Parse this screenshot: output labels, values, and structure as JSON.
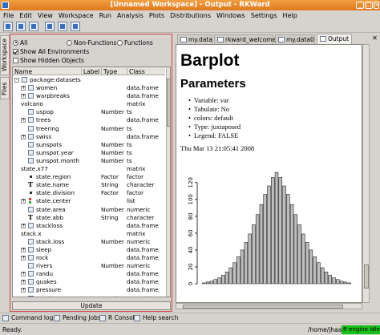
{
  "window": {
    "title": "[Unnamed Workspace] - Output - RKWard",
    "colors": {
      "titlebar": "#e88a2e",
      "selection": "#c44444",
      "r_status": "#17c11a"
    }
  },
  "menu": [
    "File",
    "Edit",
    "View",
    "Workspace",
    "Run",
    "Analysis",
    "Plots",
    "Distributions",
    "Windows",
    "Settings",
    "Help"
  ],
  "sidetabs": [
    "Workspace",
    "Files"
  ],
  "workspace": {
    "filters": {
      "all": "All",
      "non_functions": "Non-Functions",
      "functions": "Functions"
    },
    "show_all_env": "Show All Environments",
    "show_hidden": "Show Hidden Objects",
    "columns": [
      "Name",
      "Label",
      "Type",
      "Class"
    ],
    "rows": [
      {
        "exp": "-",
        "icon": "env",
        "name": "package:datasets",
        "type": "",
        "class": ""
      },
      {
        "exp": "+",
        "icon": "frame",
        "name": "women",
        "type": "",
        "class": "data.frame"
      },
      {
        "exp": "+",
        "icon": "frame",
        "name": "warpbreaks",
        "type": "",
        "class": "data.frame"
      },
      {
        "exp": "",
        "icon": "none",
        "name": "volcano",
        "type": "",
        "class": "matrix"
      },
      {
        "exp": "",
        "icon": "vec",
        "name": "uspop",
        "type": "Number",
        "class": "ts"
      },
      {
        "exp": "+",
        "icon": "frame",
        "name": "trees",
        "type": "",
        "class": "data.frame"
      },
      {
        "exp": "",
        "icon": "vec",
        "name": "treering",
        "type": "Number",
        "class": "ts"
      },
      {
        "exp": "+",
        "icon": "frame",
        "name": "swiss",
        "type": "",
        "class": "data.frame"
      },
      {
        "exp": "",
        "icon": "vec",
        "name": "sunspots",
        "type": "Number",
        "class": "ts"
      },
      {
        "exp": "",
        "icon": "vec",
        "name": "sunspot.year",
        "type": "Number",
        "class": "ts"
      },
      {
        "exp": "",
        "icon": "vec",
        "name": "sunspot.month",
        "type": "Number",
        "class": "ts"
      },
      {
        "exp": "",
        "icon": "none",
        "name": "state.x77",
        "type": "",
        "class": "matrix"
      },
      {
        "exp": "",
        "icon": "factor",
        "name": "state.region",
        "type": "Factor",
        "class": "factor"
      },
      {
        "exp": "",
        "icon": "text",
        "name": "state.name",
        "type": "String",
        "class": "character"
      },
      {
        "exp": "",
        "icon": "factor",
        "name": "state.division",
        "type": "Factor",
        "class": "factor"
      },
      {
        "exp": "+",
        "icon": "list",
        "name": "state.center",
        "type": "",
        "class": "list"
      },
      {
        "exp": "",
        "icon": "vec",
        "name": "state.area",
        "type": "Number",
        "class": "numeric"
      },
      {
        "exp": "",
        "icon": "text",
        "name": "state.abb",
        "type": "String",
        "class": "character"
      },
      {
        "exp": "+",
        "icon": "frame",
        "name": "stackloss",
        "type": "",
        "class": "data.frame"
      },
      {
        "exp": "",
        "icon": "none",
        "name": "stack.x",
        "type": "",
        "class": "matrix"
      },
      {
        "exp": "",
        "icon": "vec",
        "name": "stack.loss",
        "type": "Number",
        "class": "numeric"
      },
      {
        "exp": "+",
        "icon": "frame",
        "name": "sleep",
        "type": "",
        "class": "data.frame"
      },
      {
        "exp": "+",
        "icon": "frame",
        "name": "rock",
        "type": "",
        "class": "data.frame"
      },
      {
        "exp": "",
        "icon": "vec",
        "name": "rivers",
        "type": "Number",
        "class": "numeric"
      },
      {
        "exp": "+",
        "icon": "frame",
        "name": "randu",
        "type": "",
        "class": "data.frame"
      },
      {
        "exp": "+",
        "icon": "frame",
        "name": "quakes",
        "type": "",
        "class": "data.frame"
      },
      {
        "exp": "+",
        "icon": "frame",
        "name": "pressure",
        "type": "",
        "class": "data.frame"
      },
      {
        "exp": "",
        "icon": "vec",
        "name": "precip",
        "type": "Number",
        "class": "numeric"
      }
    ],
    "update_label": "Update"
  },
  "tabs": [
    {
      "label": "my.data",
      "active": false
    },
    {
      "label": "rkward_welcome",
      "active": false
    },
    {
      "label": "my.data0",
      "active": false
    },
    {
      "label": "Output",
      "active": true
    }
  ],
  "output": {
    "heading": "Barplot",
    "subheading": "Parameters",
    "params": [
      "Variable: var",
      "Tabulate: No",
      "colors: default",
      "Type: juxtaposed",
      "Legend: FALSE"
    ],
    "timestamp": "Thu Mar 13 21:05:41 2008"
  },
  "chart_data": {
    "type": "bar",
    "bar_color": "#bebebe",
    "values": [
      1,
      2,
      3,
      5,
      7,
      10,
      14,
      19,
      25,
      32,
      40,
      49,
      59,
      70,
      82,
      94,
      106,
      116,
      126,
      132,
      126,
      116,
      106,
      94,
      82,
      70,
      59,
      49,
      40,
      32,
      25,
      19,
      14,
      10,
      7,
      5,
      3,
      2,
      1
    ],
    "yticks": [
      0,
      20,
      40,
      60,
      80,
      100,
      120
    ],
    "ylim": [
      0,
      135
    ]
  },
  "bottom_tools": [
    "Command log",
    "Pending Jobs",
    "R Console",
    "Help search"
  ],
  "status": {
    "ready": "Ready.",
    "path": "/home/jhaas",
    "r_engine": "R engine idle"
  }
}
